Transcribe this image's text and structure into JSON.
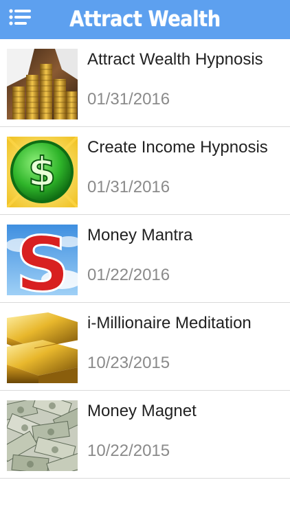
{
  "app": {
    "title": "Attract Wealth"
  },
  "navbar": {
    "menu_icon": "list-menu-icon",
    "color": "#5da0ef"
  },
  "items": [
    {
      "title": "Attract Wealth Hypnosis",
      "date": "01/31/2016",
      "thumbnail": "coin-stacks-image"
    },
    {
      "title": "Create Income Hypnosis",
      "date": "01/31/2016",
      "thumbnail": "green-dollar-coin-image"
    },
    {
      "title": "Money Mantra",
      "date": "01/22/2016",
      "thumbnail": "red-dollar-sign-sky-image"
    },
    {
      "title": "i-Millionaire Meditation",
      "date": "10/23/2015",
      "thumbnail": "gold-bars-image"
    },
    {
      "title": "Money Magnet",
      "date": "10/22/2015",
      "thumbnail": "dollar-bills-pile-image"
    }
  ]
}
